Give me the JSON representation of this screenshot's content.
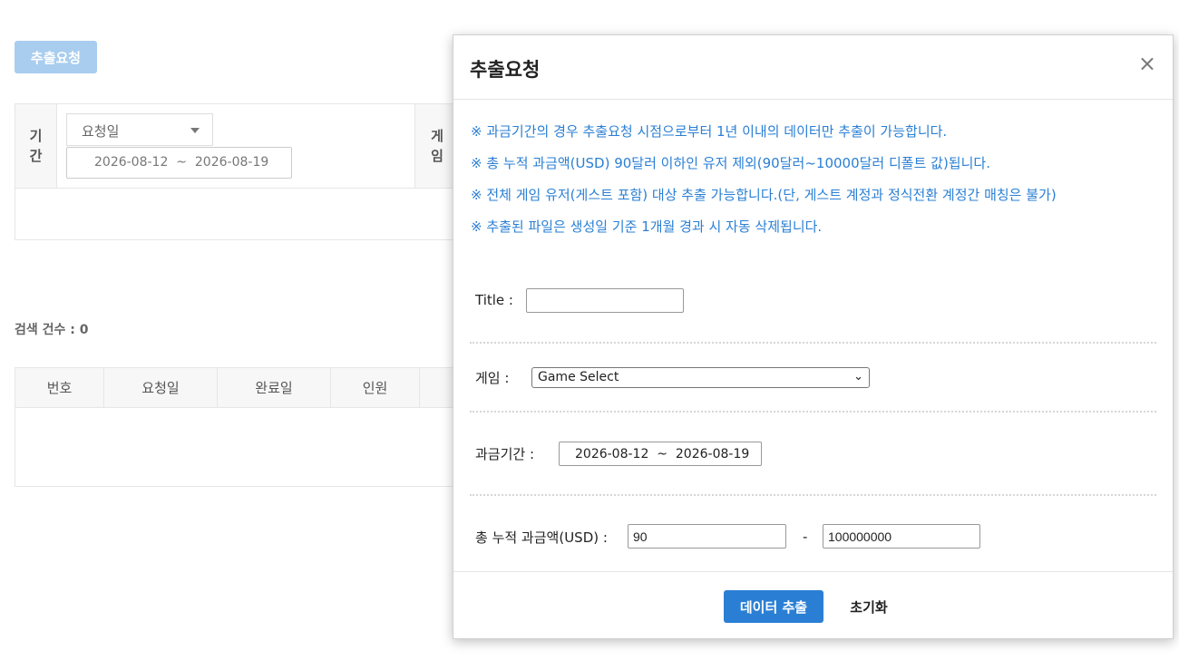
{
  "page": {
    "request_button": "추출요청",
    "filter": {
      "period_header": "기간",
      "period_type": "요청일",
      "period_range": "2026-08-12  ~  2026-08-19",
      "game_header": "게임"
    },
    "result_count": "검색 건수 : 0",
    "table_headers": [
      "번호",
      "요청일",
      "완료일",
      "인원"
    ]
  },
  "modal": {
    "title": "추출요청",
    "close": "×",
    "notices": [
      "※ 과금기간의 경우 추출요청 시점으로부터 1년 이내의 데이터만 추출이 가능합니다.",
      "※ 총 누적 과금액(USD) 90달러 이하인 유저 제외(90달러~10000달러 디폴트 값)됩니다.",
      "※ 전체 게임 유저(게스트 포함) 대상 추출 가능합니다.(단, 게스트 계정과 정식전환 계정간 매칭은 불가)",
      "※ 추출된 파일은 생성일 기준 1개월 경과 시 자동 삭제됩니다."
    ],
    "title_label": "Title :",
    "title_value": "",
    "game_label": "게임 :",
    "game_selected": "Game Select",
    "period_label": "과금기간 :",
    "period_range": "2026-08-12  ~  2026-08-19",
    "amount_label": "총 누적 과금액(USD) :",
    "amount_min": "90",
    "amount_dash": "-",
    "amount_max": "100000000",
    "extract_button": "데이터 추출",
    "reset_button": "초기화"
  },
  "colors": {
    "accent": "#2a7fd4",
    "disabled_button": "#a9cdee"
  }
}
